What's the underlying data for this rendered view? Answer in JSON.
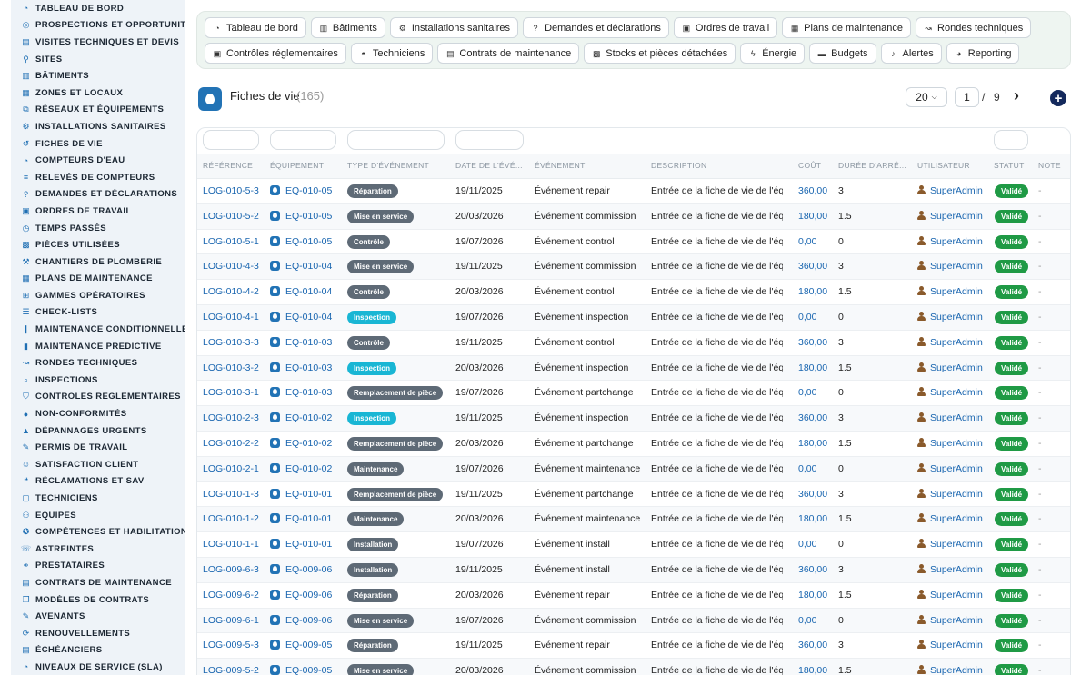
{
  "sidebar": {
    "items": [
      {
        "label": "TABLEAU DE BORD",
        "icon": "gauge-icon"
      },
      {
        "label": "PROSPECTIONS ET OPPORTUNITÉS",
        "icon": "target-icon"
      },
      {
        "label": "VISITES TECHNIQUES ET DEVIS",
        "icon": "clipboard-icon"
      },
      {
        "label": "SITES",
        "icon": "map-pin-icon"
      },
      {
        "label": "BÂTIMENTS",
        "icon": "building-icon"
      },
      {
        "label": "ZONES ET LOCAUX",
        "icon": "grid-icon"
      },
      {
        "label": "RÉSEAUX ET ÉQUIPEMENTS",
        "icon": "network-icon"
      },
      {
        "label": "INSTALLATIONS SANITAIRES",
        "icon": "gears-icon"
      },
      {
        "label": "FICHES DE VIE",
        "icon": "history-icon"
      },
      {
        "label": "COMPTEURS D'EAU",
        "icon": "gauge-icon"
      },
      {
        "label": "RELEVÉS DE COMPTEURS",
        "icon": "list-icon"
      },
      {
        "label": "DEMANDES ET DÉCLARATIONS",
        "icon": "question-icon"
      },
      {
        "label": "ORDRES DE TRAVAIL",
        "icon": "clipboard-check-icon"
      },
      {
        "label": "TEMPS PASSÉS",
        "icon": "clock-icon"
      },
      {
        "label": "PIÈCES UTILISÉES",
        "icon": "boxes-icon"
      },
      {
        "label": "CHANTIERS DE PLOMBERIE",
        "icon": "hammer-icon"
      },
      {
        "label": "PLANS DE MAINTENANCE",
        "icon": "calendar-icon"
      },
      {
        "label": "GAMMES OPÉRATOIRES",
        "icon": "sitemap-icon"
      },
      {
        "label": "CHECK-LISTS",
        "icon": "checklist-icon"
      },
      {
        "label": "MAINTENANCE CONDITIONNELLE",
        "icon": "thermometer-icon"
      },
      {
        "label": "MAINTENANCE PRÉDICTIVE",
        "icon": "chart-icon"
      },
      {
        "label": "RONDES TECHNIQUES",
        "icon": "route-icon"
      },
      {
        "label": "INSPECTIONS",
        "icon": "search-icon"
      },
      {
        "label": "CONTRÔLES RÉGLEMENTAIRES",
        "icon": "shield-icon"
      },
      {
        "label": "NON-CONFORMITÉS",
        "icon": "alert-circle-icon"
      },
      {
        "label": "DÉPANNAGES URGENTS",
        "icon": "warning-icon"
      },
      {
        "label": "PERMIS DE TRAVAIL",
        "icon": "file-signature-icon"
      },
      {
        "label": "SATISFACTION CLIENT",
        "icon": "smile-icon"
      },
      {
        "label": "RÉCLAMATIONS ET SAV",
        "icon": "comments-icon"
      },
      {
        "label": "TECHNICIENS",
        "icon": "id-badge-icon"
      },
      {
        "label": "ÉQUIPES",
        "icon": "users-icon"
      },
      {
        "label": "COMPÉTENCES ET HABILITATIONS",
        "icon": "certificate-icon"
      },
      {
        "label": "ASTREINTES",
        "icon": "phone-icon"
      },
      {
        "label": "PRESTATAIRES",
        "icon": "handshake-icon"
      },
      {
        "label": "CONTRATS DE MAINTENANCE",
        "icon": "file-contract-icon"
      },
      {
        "label": "MODÈLES DE CONTRATS",
        "icon": "copy-icon"
      },
      {
        "label": "AVENANTS",
        "icon": "file-edit-icon"
      },
      {
        "label": "RENOUVELLEMENTS",
        "icon": "refresh-icon"
      },
      {
        "label": "ÉCHÉANCIERS",
        "icon": "calendar-list-icon"
      },
      {
        "label": "NIVEAUX DE SERVICE (SLA)",
        "icon": "gauge-icon"
      }
    ]
  },
  "topnav": {
    "row1": [
      {
        "label": "Tableau de bord",
        "icon": "gauge-icon"
      },
      {
        "label": "Bâtiments",
        "icon": "building-icon"
      },
      {
        "label": "Installations sanitaires",
        "icon": "gears-icon"
      },
      {
        "label": "Demandes et déclarations",
        "icon": "question-icon"
      },
      {
        "label": "Ordres de travail",
        "icon": "clipboard-check-icon"
      },
      {
        "label": "Plans de maintenance",
        "icon": "calendar-icon"
      },
      {
        "label": "Rondes techniques",
        "icon": "route-icon"
      }
    ],
    "row2": [
      {
        "label": "Contrôles réglementaires",
        "icon": "clipboard-check-icon"
      },
      {
        "label": "Techniciens",
        "icon": "hard-hat-icon"
      },
      {
        "label": "Contrats de maintenance",
        "icon": "file-contract-icon"
      },
      {
        "label": "Stocks et pièces détachées",
        "icon": "boxes-icon"
      },
      {
        "label": "Énergie",
        "icon": "bolt-icon"
      },
      {
        "label": "Budgets",
        "icon": "money-icon"
      },
      {
        "label": "Alertes",
        "icon": "bell-icon"
      },
      {
        "label": "Reporting",
        "icon": "pie-chart-icon"
      }
    ]
  },
  "header": {
    "title": "Fiches de vie",
    "count": "(165)",
    "per_page": "20",
    "page": "1",
    "page_sep": "/",
    "page_total": "9"
  },
  "table": {
    "columns": [
      "RÉFÉRENCE",
      "ÉQUIPEMENT",
      "TYPE D'ÉVÉNEMENT",
      "DATE DE L'ÉVÉ...",
      "ÉVÉNEMENT",
      "DESCRIPTION",
      "COÛT",
      "DURÉE D'ARRÊ...",
      "UTILISATEUR",
      "STATUT",
      "NOTE"
    ],
    "rows": [
      {
        "ref": "LOG-010-5-3",
        "eq": "EQ-010-05",
        "type": "Réparation",
        "type_color": "gray",
        "date": "19/11/2025",
        "event": "Événement repair",
        "desc": "Entrée de la fiche de vie de l'équipement",
        "cost": "360,00",
        "dur": "3",
        "user": "SuperAdmin",
        "status": "Validé",
        "note": "-"
      },
      {
        "ref": "LOG-010-5-2",
        "eq": "EQ-010-05",
        "type": "Mise en service",
        "type_color": "gray",
        "date": "20/03/2026",
        "event": "Événement commission",
        "desc": "Entrée de la fiche de vie de l'équipement",
        "cost": "180,00",
        "dur": "1.5",
        "user": "SuperAdmin",
        "status": "Validé",
        "note": "-"
      },
      {
        "ref": "LOG-010-5-1",
        "eq": "EQ-010-05",
        "type": "Contrôle",
        "type_color": "gray",
        "date": "19/07/2026",
        "event": "Événement control",
        "desc": "Entrée de la fiche de vie de l'équipement",
        "cost": "0,00",
        "dur": "0",
        "user": "SuperAdmin",
        "status": "Validé",
        "note": "-"
      },
      {
        "ref": "LOG-010-4-3",
        "eq": "EQ-010-04",
        "type": "Mise en service",
        "type_color": "gray",
        "date": "19/11/2025",
        "event": "Événement commission",
        "desc": "Entrée de la fiche de vie de l'équipement",
        "cost": "360,00",
        "dur": "3",
        "user": "SuperAdmin",
        "status": "Validé",
        "note": "-"
      },
      {
        "ref": "LOG-010-4-2",
        "eq": "EQ-010-04",
        "type": "Contrôle",
        "type_color": "gray",
        "date": "20/03/2026",
        "event": "Événement control",
        "desc": "Entrée de la fiche de vie de l'équipement",
        "cost": "180,00",
        "dur": "1.5",
        "user": "SuperAdmin",
        "status": "Validé",
        "note": "-"
      },
      {
        "ref": "LOG-010-4-1",
        "eq": "EQ-010-04",
        "type": "Inspection",
        "type_color": "cyan",
        "date": "19/07/2026",
        "event": "Événement inspection",
        "desc": "Entrée de la fiche de vie de l'équipement",
        "cost": "0,00",
        "dur": "0",
        "user": "SuperAdmin",
        "status": "Validé",
        "note": "-"
      },
      {
        "ref": "LOG-010-3-3",
        "eq": "EQ-010-03",
        "type": "Contrôle",
        "type_color": "gray",
        "date": "19/11/2025",
        "event": "Événement control",
        "desc": "Entrée de la fiche de vie de l'équipement",
        "cost": "360,00",
        "dur": "3",
        "user": "SuperAdmin",
        "status": "Validé",
        "note": "-"
      },
      {
        "ref": "LOG-010-3-2",
        "eq": "EQ-010-03",
        "type": "Inspection",
        "type_color": "cyan",
        "date": "20/03/2026",
        "event": "Événement inspection",
        "desc": "Entrée de la fiche de vie de l'équipement",
        "cost": "180,00",
        "dur": "1.5",
        "user": "SuperAdmin",
        "status": "Validé",
        "note": "-"
      },
      {
        "ref": "LOG-010-3-1",
        "eq": "EQ-010-03",
        "type": "Remplacement de pièce",
        "type_color": "gray",
        "date": "19/07/2026",
        "event": "Événement partchange",
        "desc": "Entrée de la fiche de vie de l'équipement",
        "cost": "0,00",
        "dur": "0",
        "user": "SuperAdmin",
        "status": "Validé",
        "note": "-"
      },
      {
        "ref": "LOG-010-2-3",
        "eq": "EQ-010-02",
        "type": "Inspection",
        "type_color": "cyan",
        "date": "19/11/2025",
        "event": "Événement inspection",
        "desc": "Entrée de la fiche de vie de l'équipement",
        "cost": "360,00",
        "dur": "3",
        "user": "SuperAdmin",
        "status": "Validé",
        "note": "-"
      },
      {
        "ref": "LOG-010-2-2",
        "eq": "EQ-010-02",
        "type": "Remplacement de pièce",
        "type_color": "gray",
        "date": "20/03/2026",
        "event": "Événement partchange",
        "desc": "Entrée de la fiche de vie de l'équipement",
        "cost": "180,00",
        "dur": "1.5",
        "user": "SuperAdmin",
        "status": "Validé",
        "note": "-"
      },
      {
        "ref": "LOG-010-2-1",
        "eq": "EQ-010-02",
        "type": "Maintenance",
        "type_color": "gray",
        "date": "19/07/2026",
        "event": "Événement maintenance",
        "desc": "Entrée de la fiche de vie de l'équipement",
        "cost": "0,00",
        "dur": "0",
        "user": "SuperAdmin",
        "status": "Validé",
        "note": "-"
      },
      {
        "ref": "LOG-010-1-3",
        "eq": "EQ-010-01",
        "type": "Remplacement de pièce",
        "type_color": "gray",
        "date": "19/11/2025",
        "event": "Événement partchange",
        "desc": "Entrée de la fiche de vie de l'équipement",
        "cost": "360,00",
        "dur": "3",
        "user": "SuperAdmin",
        "status": "Validé",
        "note": "-"
      },
      {
        "ref": "LOG-010-1-2",
        "eq": "EQ-010-01",
        "type": "Maintenance",
        "type_color": "gray",
        "date": "20/03/2026",
        "event": "Événement maintenance",
        "desc": "Entrée de la fiche de vie de l'équipement",
        "cost": "180,00",
        "dur": "1.5",
        "user": "SuperAdmin",
        "status": "Validé",
        "note": "-"
      },
      {
        "ref": "LOG-010-1-1",
        "eq": "EQ-010-01",
        "type": "Installation",
        "type_color": "gray",
        "date": "19/07/2026",
        "event": "Événement install",
        "desc": "Entrée de la fiche de vie de l'équipement",
        "cost": "0,00",
        "dur": "0",
        "user": "SuperAdmin",
        "status": "Validé",
        "note": "-"
      },
      {
        "ref": "LOG-009-6-3",
        "eq": "EQ-009-06",
        "type": "Installation",
        "type_color": "gray",
        "date": "19/11/2025",
        "event": "Événement install",
        "desc": "Entrée de la fiche de vie de l'équipement",
        "cost": "360,00",
        "dur": "3",
        "user": "SuperAdmin",
        "status": "Validé",
        "note": "-"
      },
      {
        "ref": "LOG-009-6-2",
        "eq": "EQ-009-06",
        "type": "Réparation",
        "type_color": "gray",
        "date": "20/03/2026",
        "event": "Événement repair",
        "desc": "Entrée de la fiche de vie de l'équipement",
        "cost": "180,00",
        "dur": "1.5",
        "user": "SuperAdmin",
        "status": "Validé",
        "note": "-"
      },
      {
        "ref": "LOG-009-6-1",
        "eq": "EQ-009-06",
        "type": "Mise en service",
        "type_color": "gray",
        "date": "19/07/2026",
        "event": "Événement commission",
        "desc": "Entrée de la fiche de vie de l'équipement",
        "cost": "0,00",
        "dur": "0",
        "user": "SuperAdmin",
        "status": "Validé",
        "note": "-"
      },
      {
        "ref": "LOG-009-5-3",
        "eq": "EQ-009-05",
        "type": "Réparation",
        "type_color": "gray",
        "date": "19/11/2025",
        "event": "Événement repair",
        "desc": "Entrée de la fiche de vie de l'équipement",
        "cost": "360,00",
        "dur": "3",
        "user": "SuperAdmin",
        "status": "Validé",
        "note": "-"
      },
      {
        "ref": "LOG-009-5-2",
        "eq": "EQ-009-05",
        "type": "Mise en service",
        "type_color": "gray",
        "date": "20/03/2026",
        "event": "Événement commission",
        "desc": "Entrée de la fiche de vie de l'équipement",
        "cost": "180,00",
        "dur": "1.5",
        "user": "SuperAdmin",
        "status": "Validé",
        "note": "-"
      }
    ]
  },
  "colors": {
    "link": "#1a66b0",
    "badge_gray": "#5e6a76",
    "badge_cyan": "#19b6d4",
    "status_green": "#1f9a45",
    "add_button": "#14295c"
  }
}
